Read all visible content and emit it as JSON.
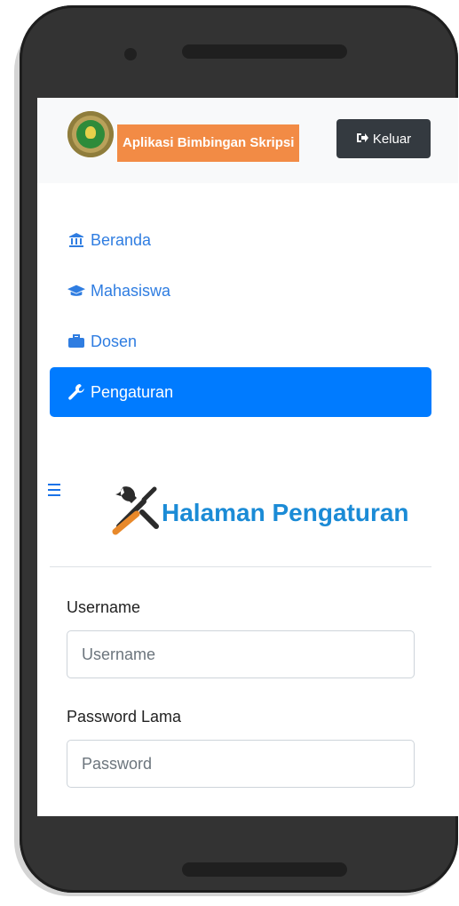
{
  "navbar": {
    "brand": "Aplikasi Bimbingan Skripsi",
    "logout_label": "Keluar"
  },
  "menu": {
    "items": [
      {
        "label": "Beranda",
        "icon": "bank-icon"
      },
      {
        "label": "Mahasiswa",
        "icon": "graduation-cap-icon"
      },
      {
        "label": "Dosen",
        "icon": "briefcase-icon"
      },
      {
        "label": "Pengaturan",
        "icon": "wrench-icon",
        "active": true
      }
    ]
  },
  "page": {
    "title": "Halaman Pengaturan"
  },
  "form": {
    "username_label": "Username",
    "username_placeholder": "Username",
    "old_password_label": "Password Lama",
    "old_password_placeholder": "Password"
  },
  "colors": {
    "accent": "#007bff",
    "brand_bg": "#f28b45",
    "title": "#1b8bd6",
    "navbar_bg": "#f8f9fa",
    "logout_bg": "#343a40"
  }
}
